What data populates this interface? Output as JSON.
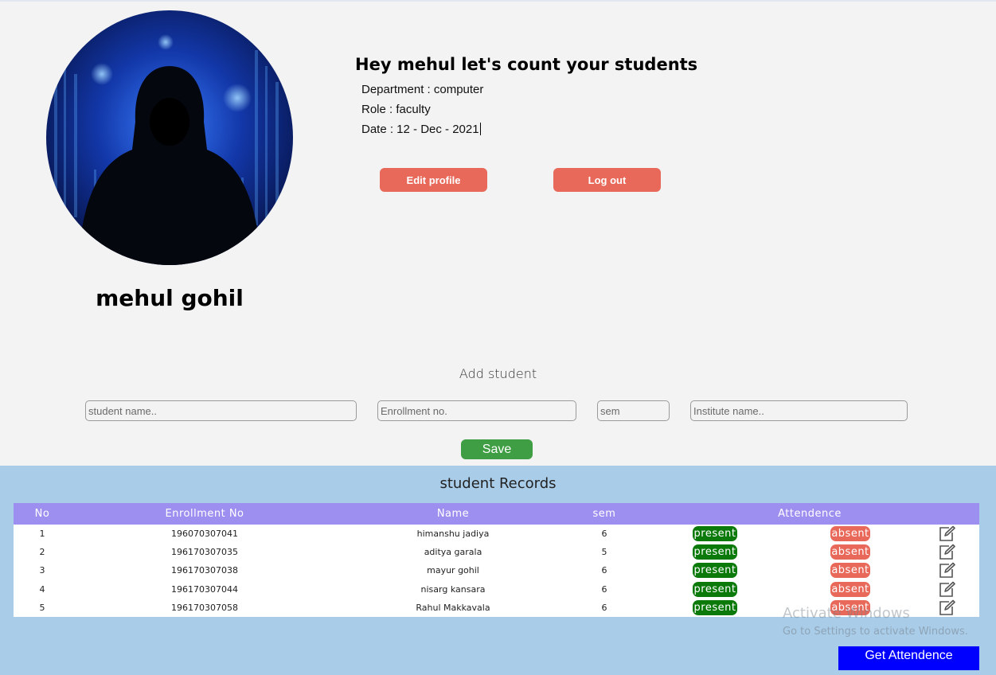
{
  "profile": {
    "greeting": "Hey mehul let's count your students",
    "department": "Department : computer",
    "role": "Role : faculty",
    "date": "Date : 12 - Dec - 2021",
    "full_name": "mehul gohil",
    "edit_label": "Edit profile",
    "logout_label": "Log out"
  },
  "add_student": {
    "title": "Add student",
    "name_placeholder": "student name..",
    "enrollment_placeholder": "Enrollment no.",
    "sem_placeholder": "sem",
    "institute_placeholder": "Institute name..",
    "save_label": "Save"
  },
  "records": {
    "title": "student Records",
    "headers": [
      "No",
      "Enrollment No",
      "Name",
      "sem",
      "Attendence"
    ],
    "present_label": "present",
    "absent_label": "absent",
    "rows": [
      {
        "no": "1",
        "enrollment": "196070307041",
        "name": "himanshu jadiya",
        "sem": "6"
      },
      {
        "no": "2",
        "enrollment": "196170307035",
        "name": "aditya garala",
        "sem": "5"
      },
      {
        "no": "3",
        "enrollment": "196170307038",
        "name": "mayur gohil",
        "sem": "6"
      },
      {
        "no": "4",
        "enrollment": "196170307044",
        "name": "nisarg kansara",
        "sem": "6"
      },
      {
        "no": "5",
        "enrollment": "196170307058",
        "name": "Rahul Makkavala",
        "sem": "6"
      }
    ],
    "get_attendance_label": "Get Attendence"
  },
  "os_watermark": {
    "line1": "Activate Windows",
    "line2": "Go to Settings to activate Windows."
  },
  "colors": {
    "header_purple": "#9d8ff0",
    "records_bg": "#a9cde9",
    "present_green": "#0b7a0b",
    "absent_red": "#e8695a",
    "save_green": "#3f9e43",
    "action_blue": "#0000ff"
  }
}
